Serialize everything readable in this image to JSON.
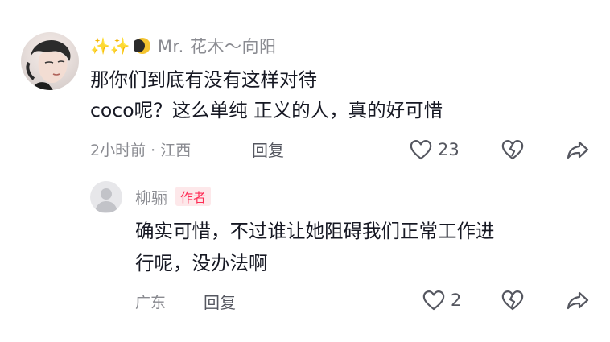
{
  "comment": {
    "username_prefix_emoji": "✨✨",
    "username": "Mr. 花木～向阳",
    "text_line1": "那你们到底有没有这样对待",
    "text_line2": "coco呢？这么单纯 正义的人，真的好可惜",
    "meta": "2小时前 · 江西",
    "reply_label": "回复",
    "like_count": "23",
    "icons": [
      "heart-icon",
      "broken-heart-icon",
      "share-arrow-icon"
    ]
  },
  "reply": {
    "username": "柳骊",
    "badge": "作者",
    "text_line1": "确实可惜，不过谁让她阻碍我们正常工作进",
    "text_line2": "行呢，没办法啊",
    "meta": "广东",
    "reply_label": "回复",
    "like_count": "2",
    "icons": [
      "heart-icon",
      "broken-heart-icon",
      "share-arrow-icon"
    ]
  },
  "colors": {
    "text_primary": "#161823",
    "text_secondary": "#8a8b91",
    "author_badge_bg": "#fde8ea",
    "author_badge_text": "#fe2c55"
  }
}
